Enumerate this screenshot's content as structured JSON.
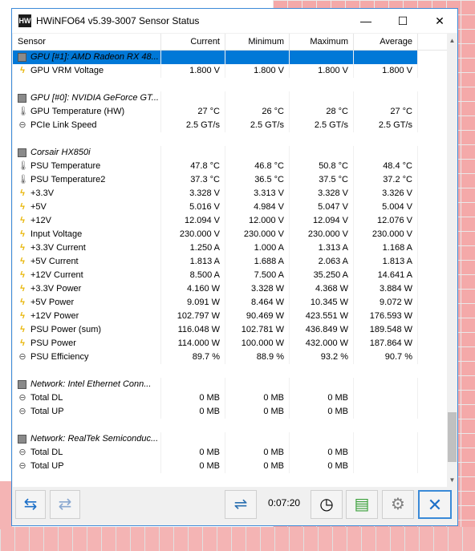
{
  "window": {
    "title": "HWiNFO64 v5.39-3007 Sensor Status",
    "app_icon_text": "HW",
    "minimize_glyph": "—",
    "maximize_glyph": "☐",
    "close_glyph": "✕"
  },
  "columns": [
    "Sensor",
    "Current",
    "Minimum",
    "Maximum",
    "Average"
  ],
  "rows": [
    {
      "type": "group",
      "name": "GPU [#1]: AMD Radeon RX 48...",
      "icon": "chip-icon",
      "selected": true
    },
    {
      "type": "sensor",
      "name": "GPU VRM Voltage",
      "icon": "bolt-icon",
      "current": "1.800 V",
      "min": "1.800 V",
      "max": "1.800 V",
      "avg": "1.800 V"
    },
    {
      "type": "blank"
    },
    {
      "type": "group",
      "name": "GPU [#0]: NVIDIA GeForce GT...",
      "icon": "chip-icon"
    },
    {
      "type": "sensor",
      "name": "GPU Temperature (HW)",
      "icon": "thermometer-icon",
      "current": "27 °C",
      "min": "26 °C",
      "max": "28 °C",
      "avg": "27 °C"
    },
    {
      "type": "sensor",
      "name": "PCIe Link Speed",
      "icon": "circle-icon",
      "current": "2.5 GT/s",
      "min": "2.5 GT/s",
      "max": "2.5 GT/s",
      "avg": "2.5 GT/s"
    },
    {
      "type": "blank"
    },
    {
      "type": "group",
      "name": "Corsair HX850i",
      "icon": "chip-icon"
    },
    {
      "type": "sensor",
      "name": "PSU Temperature",
      "icon": "thermometer-icon",
      "current": "47.8 °C",
      "min": "46.8 °C",
      "max": "50.8 °C",
      "avg": "48.4 °C"
    },
    {
      "type": "sensor",
      "name": "PSU Temperature2",
      "icon": "thermometer-icon",
      "current": "37.3 °C",
      "min": "36.5 °C",
      "max": "37.5 °C",
      "avg": "37.2 °C"
    },
    {
      "type": "sensor",
      "name": "+3.3V",
      "icon": "bolt-icon",
      "current": "3.328 V",
      "min": "3.313 V",
      "max": "3.328 V",
      "avg": "3.326 V"
    },
    {
      "type": "sensor",
      "name": "+5V",
      "icon": "bolt-icon",
      "current": "5.016 V",
      "min": "4.984 V",
      "max": "5.047 V",
      "avg": "5.004 V"
    },
    {
      "type": "sensor",
      "name": "+12V",
      "icon": "bolt-icon",
      "current": "12.094 V",
      "min": "12.000 V",
      "max": "12.094 V",
      "avg": "12.076 V"
    },
    {
      "type": "sensor",
      "name": "Input Voltage",
      "icon": "bolt-icon",
      "current": "230.000 V",
      "min": "230.000 V",
      "max": "230.000 V",
      "avg": "230.000 V"
    },
    {
      "type": "sensor",
      "name": "+3.3V Current",
      "icon": "bolt-icon",
      "current": "1.250 A",
      "min": "1.000 A",
      "max": "1.313 A",
      "avg": "1.168 A"
    },
    {
      "type": "sensor",
      "name": "+5V Current",
      "icon": "bolt-icon",
      "current": "1.813 A",
      "min": "1.688 A",
      "max": "2.063 A",
      "avg": "1.813 A"
    },
    {
      "type": "sensor",
      "name": "+12V Current",
      "icon": "bolt-icon",
      "current": "8.500 A",
      "min": "7.500 A",
      "max": "35.250 A",
      "avg": "14.641 A"
    },
    {
      "type": "sensor",
      "name": "+3.3V Power",
      "icon": "bolt-icon",
      "current": "4.160 W",
      "min": "3.328 W",
      "max": "4.368 W",
      "avg": "3.884 W"
    },
    {
      "type": "sensor",
      "name": "+5V Power",
      "icon": "bolt-icon",
      "current": "9.091 W",
      "min": "8.464 W",
      "max": "10.345 W",
      "avg": "9.072 W"
    },
    {
      "type": "sensor",
      "name": "+12V Power",
      "icon": "bolt-icon",
      "current": "102.797 W",
      "min": "90.469 W",
      "max": "423.551 W",
      "avg": "176.593 W"
    },
    {
      "type": "sensor",
      "name": "PSU Power (sum)",
      "icon": "bolt-icon",
      "current": "116.048 W",
      "min": "102.781 W",
      "max": "436.849 W",
      "avg": "189.548 W"
    },
    {
      "type": "sensor",
      "name": "PSU Power",
      "icon": "bolt-icon",
      "current": "114.000 W",
      "min": "100.000 W",
      "max": "432.000 W",
      "avg": "187.864 W"
    },
    {
      "type": "sensor",
      "name": "PSU Efficiency",
      "icon": "circle-icon",
      "current": "89.7 %",
      "min": "88.9 %",
      "max": "93.2 %",
      "avg": "90.7 %"
    },
    {
      "type": "blank"
    },
    {
      "type": "group",
      "name": "Network: Intel Ethernet Conn...",
      "icon": "chip-icon"
    },
    {
      "type": "sensor",
      "name": "Total DL",
      "icon": "circle-icon",
      "current": "0 MB",
      "min": "0 MB",
      "max": "0 MB",
      "avg": ""
    },
    {
      "type": "sensor",
      "name": "Total UP",
      "icon": "circle-icon",
      "current": "0 MB",
      "min": "0 MB",
      "max": "0 MB",
      "avg": ""
    },
    {
      "type": "blank"
    },
    {
      "type": "group",
      "name": "Network: RealTek Semiconduc...",
      "icon": "chip-icon"
    },
    {
      "type": "sensor",
      "name": "Total DL",
      "icon": "circle-icon",
      "current": "0 MB",
      "min": "0 MB",
      "max": "0 MB",
      "avg": ""
    },
    {
      "type": "sensor",
      "name": "Total UP",
      "icon": "circle-icon",
      "current": "0 MB",
      "min": "0 MB",
      "max": "0 MB",
      "avg": ""
    }
  ],
  "footer": {
    "timer": "0:07:20"
  },
  "colors": {
    "selection": "#0078d7",
    "accent": "#1e70c8",
    "bolt": "#e8b400"
  }
}
